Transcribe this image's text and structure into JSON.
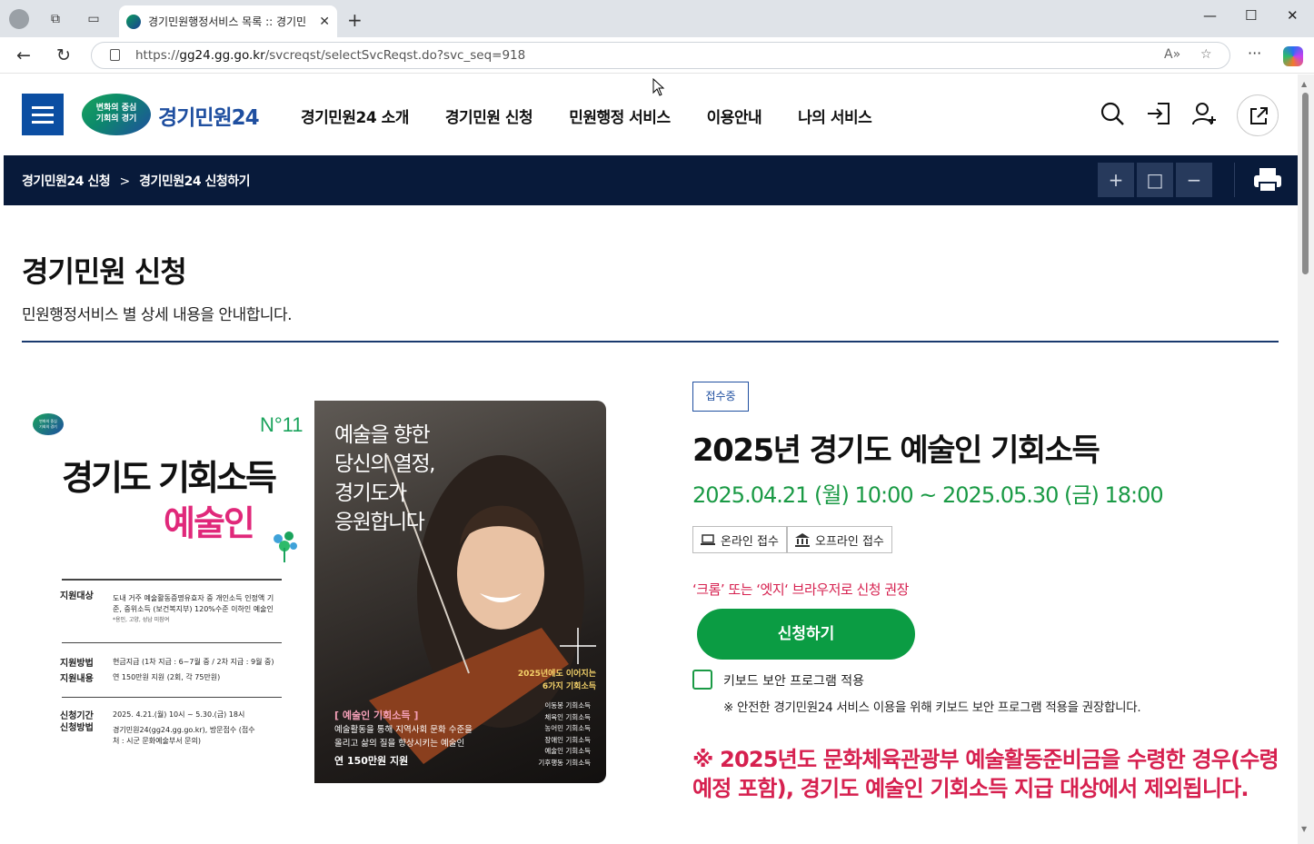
{
  "browser": {
    "tab_title": "경기민원행정서비스 목록 :: 경기민",
    "url_prefix": "https://",
    "url_host": "gg24.gg.go.kr",
    "url_path": "/svcreqst/selectSvcReqst.do?svc_seq=918"
  },
  "header": {
    "logo_mark": "변화의 중심\n기회의 경기",
    "logo_text": "경기민원24",
    "nav": [
      "경기민원24 소개",
      "경기민원 신청",
      "민원행정 서비스",
      "이용안내",
      "나의 서비스"
    ]
  },
  "breadcrumb": {
    "level1": "경기민원24 신청",
    "separator": ">",
    "level2": "경기민원24 신청하기",
    "zoom_in": "+",
    "zoom_reset": "□",
    "zoom_out": "−"
  },
  "page": {
    "title": "경기민원 신청",
    "subtitle": "민원행정서비스 별 상세 내용을 안내합니다."
  },
  "poster": {
    "badge": "변화의 중심\n기회의 경기",
    "number": "N°11",
    "title": "경기도 기회소득",
    "subtitle": "예술인",
    "rows": [
      {
        "label": "지원대상",
        "text": "도내 거주 예술활동증명유효자 중 개인소득 인정액 기준, 중위소득 (보건복지부) 120%수준 이하인 예술인",
        "small": "*용인, 고양, 성남 미참여"
      },
      {
        "label": "지원방법",
        "text": "현금지급 (1차 지급 : 6~7월 중 / 2차 지급 : 9월 중)"
      },
      {
        "label": "지원내용",
        "text": "연 150만원 지원 (2회, 각 75만원)"
      },
      {
        "label": "신청기간",
        "text": "2025. 4.21.(월) 10시 ~ 5.30.(금) 18시"
      },
      {
        "label": "신청방법",
        "text": "경기민원24(gg24.gg.go.kr), 방문접수 (접수처 : 시군 문화예술부서 문의)"
      }
    ],
    "slogan": "예술을 향한\n당신의 열정,\n경기도가\n응원합니다",
    "series_title": "2025년에도 이어지는\n6가지 기회소득",
    "series_list": "이동봉 기회소득\n체육인 기회소득\n농어민 기회소득\n장애인 기회소득\n예술인 기회소득\n기후행동 기회소득",
    "box_title": "[ 예술인 기회소득 ]",
    "box_text": "예술활동을 통해 지역사회 문화 수준을\n올리고 삶의 질을 향상시키는 예술인",
    "box_amount": "연 150만원 지원"
  },
  "service": {
    "status": "접수중",
    "title": "2025년 경기도 예술인 기회소득",
    "period": "2025.04.21 (월) 10:00 ~ 2025.05.30 (금) 18:00",
    "receive_online": "온라인 접수",
    "receive_offline": "오프라인 접수",
    "browser_warning": "‘크롬’ 또는 ‘엣지‘ 브라우저로 신청 권장",
    "apply_label": "신청하기",
    "keyboard_label": "키보드 보안 프로그램 적용",
    "keyboard_note": "※ 안전한 경기민원24 서비스 이용을 위해 키보드 보안 프로그램 적용을 권장합니다.",
    "exclusion_notice": "※ 2025년도 문화체육관광부 예술활동준비금을 수령한 경우(수령 예정 포함), 경기도 예술인 기회소득 지급 대상에서 제외됩니다."
  },
  "colors": {
    "navy": "#081a3a",
    "brand_blue": "#1f4fa0",
    "green": "#1a9a45",
    "apply_green": "#0b9c43",
    "warning_red": "#d6204f",
    "pink": "#e0287a"
  }
}
